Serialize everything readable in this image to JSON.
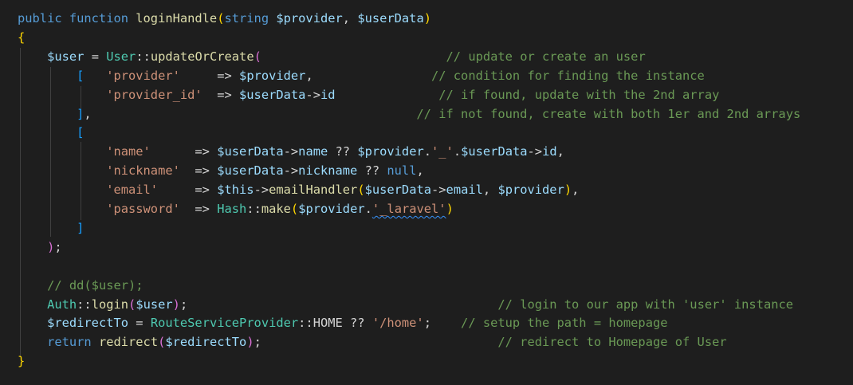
{
  "editor": {
    "lines": [
      [
        [
          "kw",
          "public function "
        ],
        [
          "fn",
          "loginHandle"
        ],
        [
          "b1",
          "("
        ],
        [
          "kw",
          "string "
        ],
        [
          "var",
          "$provider"
        ],
        [
          "op",
          ", "
        ],
        [
          "var",
          "$userData"
        ],
        [
          "b1",
          ")"
        ]
      ],
      [
        [
          "b1",
          "{"
        ]
      ],
      [
        [
          "op",
          "    "
        ],
        [
          "var",
          "$user"
        ],
        [
          "op",
          " = "
        ],
        [
          "cls",
          "User"
        ],
        [
          "op",
          "::"
        ],
        [
          "fn",
          "updateOrCreate"
        ],
        [
          "b2",
          "("
        ],
        [
          "op",
          "                         "
        ],
        [
          "com",
          "// update or create an user"
        ]
      ],
      [
        [
          "op",
          "        "
        ],
        [
          "b3",
          "["
        ],
        [
          "op",
          "   "
        ],
        [
          "str",
          "'provider'"
        ],
        [
          "op",
          "     => "
        ],
        [
          "var",
          "$provider"
        ],
        [
          "op",
          ",                "
        ],
        [
          "com",
          "// condition for finding the instance"
        ]
      ],
      [
        [
          "op",
          "            "
        ],
        [
          "str",
          "'provider_id'"
        ],
        [
          "op",
          "  => "
        ],
        [
          "var",
          "$userData"
        ],
        [
          "op",
          "->"
        ],
        [
          "var",
          "id"
        ],
        [
          "op",
          "              "
        ],
        [
          "com",
          "// if found, update with the 2nd array"
        ]
      ],
      [
        [
          "op",
          "        "
        ],
        [
          "b3",
          "]"
        ],
        [
          "op",
          ",                                            "
        ],
        [
          "com",
          "// if not found, create with both 1er and 2nd arrays"
        ]
      ],
      [
        [
          "op",
          "        "
        ],
        [
          "b3",
          "["
        ]
      ],
      [
        [
          "op",
          "            "
        ],
        [
          "str",
          "'name'"
        ],
        [
          "op",
          "      => "
        ],
        [
          "var",
          "$userData"
        ],
        [
          "op",
          "->"
        ],
        [
          "var",
          "name"
        ],
        [
          "op",
          " ?? "
        ],
        [
          "var",
          "$provider"
        ],
        [
          "op",
          "."
        ],
        [
          "str",
          "'_'"
        ],
        [
          "op",
          "."
        ],
        [
          "var",
          "$userData"
        ],
        [
          "op",
          "->"
        ],
        [
          "var",
          "id"
        ],
        [
          "op",
          ","
        ]
      ],
      [
        [
          "op",
          "            "
        ],
        [
          "str",
          "'nickname'"
        ],
        [
          "op",
          "  => "
        ],
        [
          "var",
          "$userData"
        ],
        [
          "op",
          "->"
        ],
        [
          "var",
          "nickname"
        ],
        [
          "op",
          " ?? "
        ],
        [
          "kw",
          "null"
        ],
        [
          "op",
          ","
        ]
      ],
      [
        [
          "op",
          "            "
        ],
        [
          "str",
          "'email'"
        ],
        [
          "op",
          "     => "
        ],
        [
          "var",
          "$this"
        ],
        [
          "op",
          "->"
        ],
        [
          "fn",
          "emailHandler"
        ],
        [
          "b1",
          "("
        ],
        [
          "var",
          "$userData"
        ],
        [
          "op",
          "->"
        ],
        [
          "var",
          "email"
        ],
        [
          "op",
          ", "
        ],
        [
          "var",
          "$provider"
        ],
        [
          "b1",
          ")"
        ],
        [
          "op",
          ","
        ]
      ],
      [
        [
          "op",
          "            "
        ],
        [
          "str",
          "'password'"
        ],
        [
          "op",
          "  => "
        ],
        [
          "cls",
          "Hash"
        ],
        [
          "op",
          "::"
        ],
        [
          "fn",
          "make"
        ],
        [
          "b1",
          "("
        ],
        [
          "var",
          "$provider"
        ],
        [
          "op",
          "."
        ],
        [
          "str",
          "'_laravel'"
        ],
        [
          "b1",
          ")"
        ]
      ],
      [
        [
          "op",
          "        "
        ],
        [
          "b3",
          "]"
        ]
      ],
      [
        [
          "op",
          "    "
        ],
        [
          "b2",
          ")"
        ],
        [
          "op",
          ";"
        ]
      ],
      [],
      [
        [
          "op",
          "    "
        ],
        [
          "com",
          "// dd($user);"
        ]
      ],
      [
        [
          "op",
          "    "
        ],
        [
          "cls",
          "Auth"
        ],
        [
          "op",
          "::"
        ],
        [
          "fn",
          "login"
        ],
        [
          "b2",
          "("
        ],
        [
          "var",
          "$user"
        ],
        [
          "b2",
          ")"
        ],
        [
          "op",
          ";                                          "
        ],
        [
          "com",
          "// login to our app with 'user' instance"
        ]
      ],
      [
        [
          "op",
          "    "
        ],
        [
          "var",
          "$redirectTo"
        ],
        [
          "op",
          " = "
        ],
        [
          "cls",
          "RouteServiceProvider"
        ],
        [
          "op",
          "::HOME ?? "
        ],
        [
          "str",
          "'/home'"
        ],
        [
          "op",
          ";    "
        ],
        [
          "com",
          "// setup the path = homepage"
        ]
      ],
      [
        [
          "op",
          "    "
        ],
        [
          "kw",
          "return "
        ],
        [
          "fn",
          "redirect"
        ],
        [
          "b2",
          "("
        ],
        [
          "var",
          "$redirectTo"
        ],
        [
          "b2",
          ")"
        ],
        [
          "op",
          ";                                "
        ],
        [
          "com",
          "// redirect to Homepage of User"
        ]
      ],
      [
        [
          "b1",
          "}"
        ]
      ]
    ]
  },
  "colors": {
    "background": "#1e1e1e",
    "keyword": "#569cd6",
    "function": "#dcdcaa",
    "variable": "#9cdcfe",
    "class": "#4ec9b0",
    "string": "#ce9178",
    "comment": "#6a9955",
    "bracket_level1": "#ffd700",
    "bracket_level2": "#da70d6",
    "bracket_level3": "#179fff"
  }
}
